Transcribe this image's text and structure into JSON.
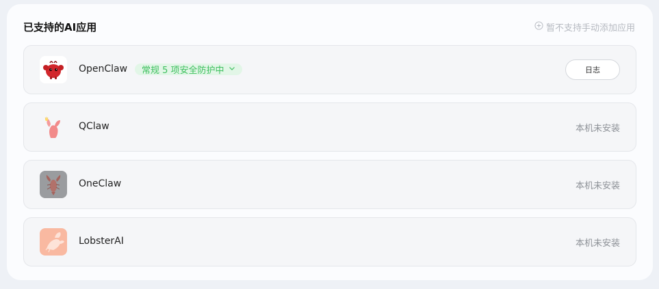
{
  "section": {
    "title": "已支持的AI应用",
    "add_link": "暂不支持手动添加应用"
  },
  "apps": [
    {
      "name": "OpenClaw",
      "icon": "red-crab-mascot-icon",
      "badge": "常规 5 项安全防护中",
      "action": "日志"
    },
    {
      "name": "QClaw",
      "icon": "pink-claw-icon",
      "status": "本机未安装"
    },
    {
      "name": "OneClaw",
      "icon": "gray-lobster-icon",
      "status": "本机未安装"
    },
    {
      "name": "LobsterAI",
      "icon": "peach-lobster-icon",
      "status": "本机未安装"
    }
  ],
  "colors": {
    "badge_text": "#3cbf5d",
    "badge_bg": "#e2f6e7",
    "muted_text": "#8d9197"
  }
}
